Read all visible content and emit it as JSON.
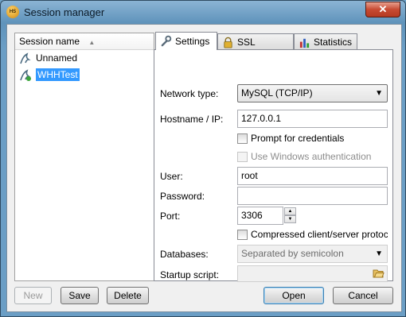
{
  "window": {
    "title": "Session manager",
    "app_icon": "HS",
    "close_symbol": "✕"
  },
  "session_list": {
    "column_header": "Session name",
    "sort_indicator": "▲",
    "items": [
      {
        "label": "Unnamed",
        "selected": false
      },
      {
        "label": "WHHTest",
        "selected": true
      }
    ]
  },
  "left_buttons": {
    "new": "New",
    "save": "Save",
    "delete": "Delete"
  },
  "tabs": [
    {
      "label": "Settings",
      "icon": "wrench-icon",
      "active": true
    },
    {
      "label": "SSL options",
      "icon": "lock-icon",
      "active": false
    },
    {
      "label": "Statistics",
      "icon": "bar-chart-icon",
      "active": false
    }
  ],
  "settings": {
    "network_type_label": "Network type:",
    "network_type_value": "MySQL (TCP/IP)",
    "hostname_label": "Hostname / IP:",
    "hostname_value": "127.0.0.1",
    "prompt_credentials": "Prompt for credentials",
    "windows_auth": "Use Windows authentication",
    "user_label": "User:",
    "user_value": "root",
    "password_label": "Password:",
    "password_value": "",
    "port_label": "Port:",
    "port_value": "3306",
    "compressed": "Compressed client/server protoco",
    "databases_label": "Databases:",
    "databases_value": "Separated by semicolon",
    "startup_label": "Startup script:",
    "startup_value": ""
  },
  "dialog_buttons": {
    "open": "Open",
    "cancel": "Cancel"
  }
}
